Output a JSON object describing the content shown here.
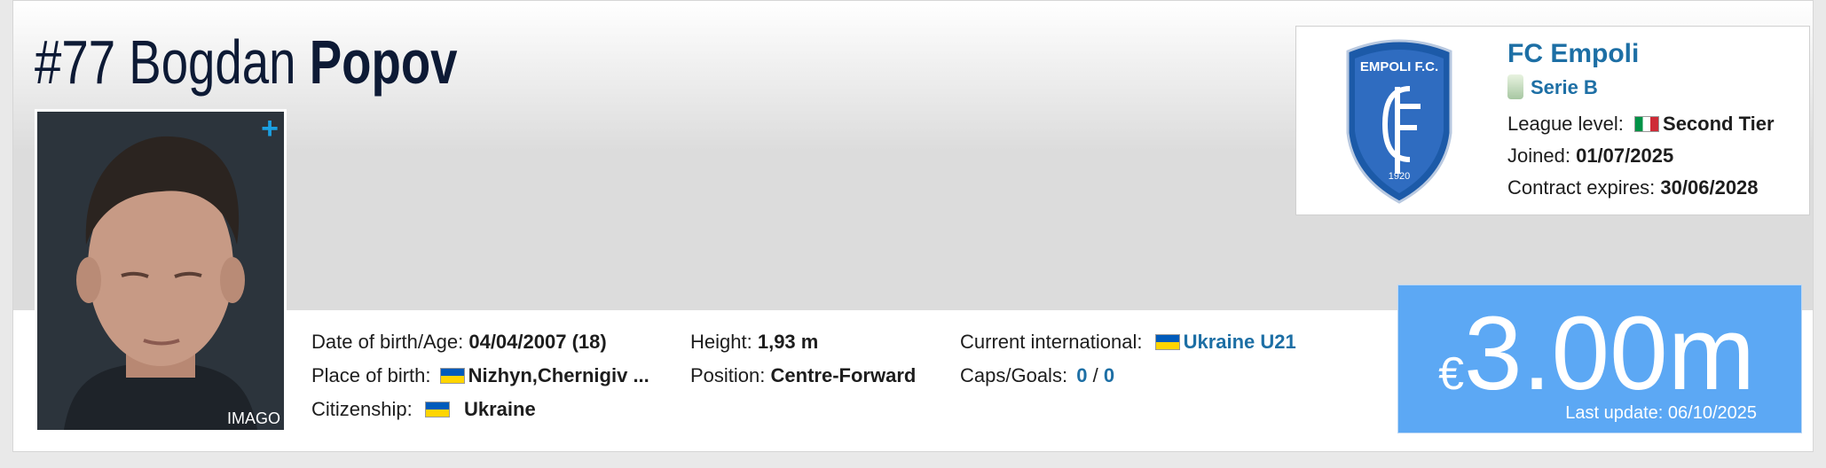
{
  "player": {
    "number": "#77",
    "first_name": "Bogdan",
    "last_name": "Popov",
    "photo_credit": "IMAGO",
    "photo_add": "+"
  },
  "details": {
    "dob_label": "Date of birth/Age:",
    "dob_value": "04/04/2007 (18)",
    "pob_label": "Place of birth:",
    "pob_value": "Nizhyn,Chernigiv ...",
    "citizenship_label": "Citizenship:",
    "citizenship_value": "Ukraine",
    "height_label": "Height:",
    "height_value": "1,93 m",
    "position_label": "Position:",
    "position_value": "Centre-Forward",
    "international_label": "Current international:",
    "international_value": "Ukraine U21",
    "caps_label": "Caps/Goals:",
    "caps_value": "0",
    "caps_sep": "/",
    "goals_value": "0"
  },
  "club": {
    "crest_top_text": "EMPOLI F.C.",
    "crest_year": "1920",
    "name": "FC Empoli",
    "league": "Serie B",
    "league_level_label": "League level:",
    "league_level_value": "Second Tier",
    "joined_label": "Joined:",
    "joined_value": "01/07/2025",
    "contract_label": "Contract expires:",
    "contract_value": "30/06/2028"
  },
  "market_value": {
    "currency": "€",
    "amount": "3.00m",
    "last_update": "Last update: 06/10/2025"
  },
  "colors": {
    "link": "#1d6fa5",
    "value_bg": "#5ca8f4",
    "title": "#0d1a35",
    "plus": "#1ba0e2"
  }
}
